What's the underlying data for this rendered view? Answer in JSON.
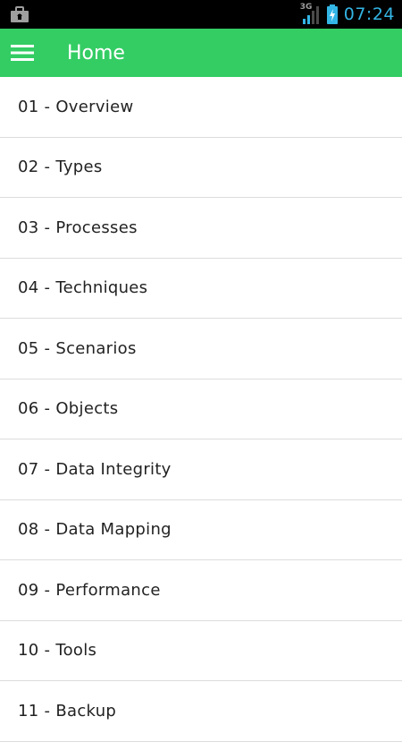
{
  "status_bar": {
    "time": "07:24",
    "network": "3G",
    "icons": [
      "briefcase-icon",
      "signal-icon",
      "battery-charging-icon"
    ]
  },
  "app_bar": {
    "title": "Home",
    "menu_icon": "hamburger-menu-icon",
    "background": "#34cd64"
  },
  "list": {
    "items": [
      {
        "label": "01 - Overview"
      },
      {
        "label": "02 - Types"
      },
      {
        "label": "03 - Processes"
      },
      {
        "label": "04 - Techniques"
      },
      {
        "label": "05 - Scenarios"
      },
      {
        "label": "06 - Objects"
      },
      {
        "label": "07 - Data Integrity"
      },
      {
        "label": "08 - Data Mapping"
      },
      {
        "label": "09 - Performance"
      },
      {
        "label": "10 - Tools"
      },
      {
        "label": "11 - Backup"
      }
    ]
  }
}
